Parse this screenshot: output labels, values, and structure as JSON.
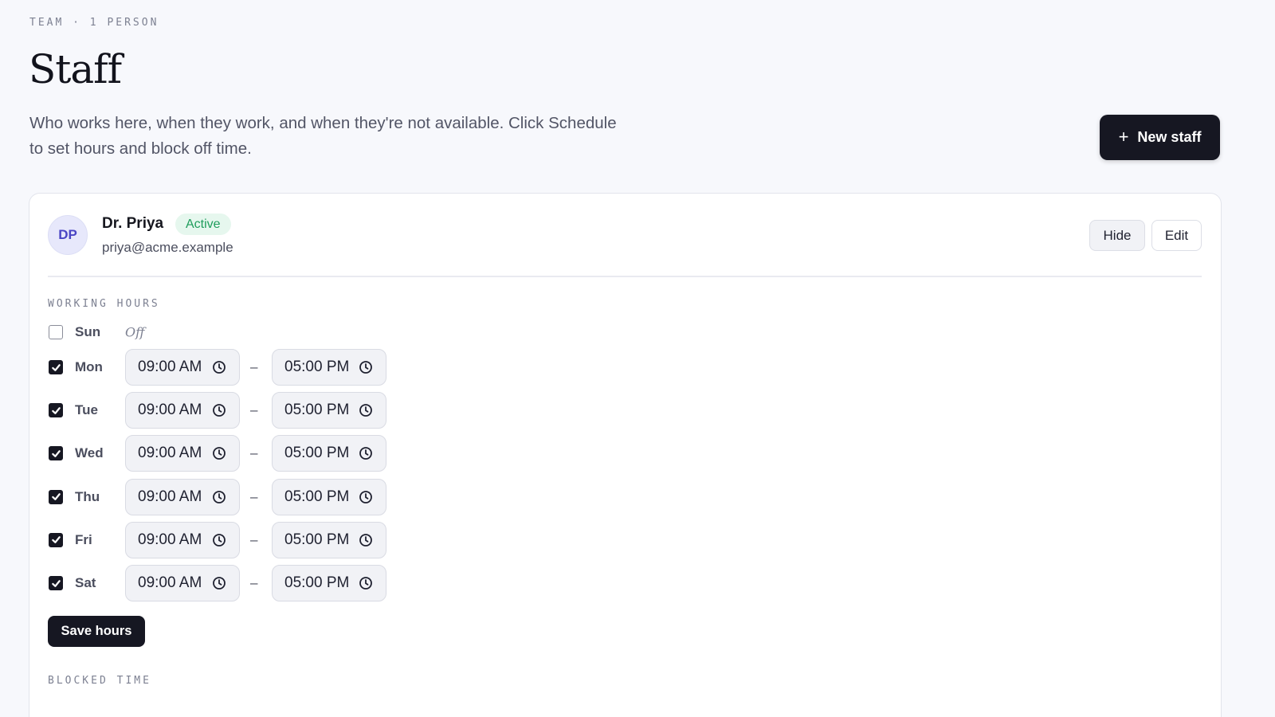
{
  "header": {
    "eyebrow": "TEAM · 1 PERSON",
    "title": "Staff",
    "subtitle": "Who works here, when they work, and when they're not available. Click Schedule to set hours and block off time.",
    "new_staff_label": "New staff",
    "new_staff_icon": "plus-icon"
  },
  "staff": {
    "initials": "DP",
    "name": "Dr. Priya",
    "status": "Active",
    "email": "priya@acme.example",
    "hide_label": "Hide",
    "edit_label": "Edit"
  },
  "working_hours": {
    "label": "WORKING HOURS",
    "off_label": "Off",
    "days": [
      {
        "day": "Sun",
        "enabled": false
      },
      {
        "day": "Mon",
        "enabled": true,
        "start": "09:00 AM",
        "end": "05:00 PM"
      },
      {
        "day": "Tue",
        "enabled": true,
        "start": "09:00 AM",
        "end": "05:00 PM"
      },
      {
        "day": "Wed",
        "enabled": true,
        "start": "09:00 AM",
        "end": "05:00 PM"
      },
      {
        "day": "Thu",
        "enabled": true,
        "start": "09:00 AM",
        "end": "05:00 PM"
      },
      {
        "day": "Fri",
        "enabled": true,
        "start": "09:00 AM",
        "end": "05:00 PM"
      },
      {
        "day": "Sat",
        "enabled": true,
        "start": "09:00 AM",
        "end": "05:00 PM"
      }
    ],
    "separator": "–",
    "save_label": "Save hours"
  },
  "blocked_time": {
    "label": "BLOCKED TIME"
  },
  "colors": {
    "background": "#f7f8fc",
    "primary_button": "#161722",
    "active_badge_bg": "#e6f7ee",
    "active_badge_text": "#1f9d5c",
    "avatar_bg": "#e7e8fb",
    "avatar_text": "#4a45c4"
  }
}
